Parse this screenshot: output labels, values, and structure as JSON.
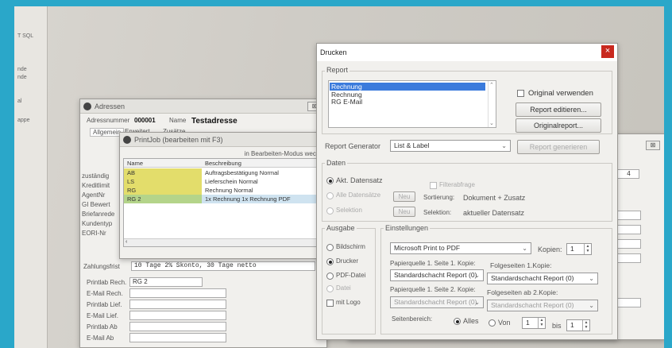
{
  "desktop": {
    "left_items": [
      "T SQL",
      "nde",
      "nde",
      "al",
      "appe"
    ]
  },
  "address_window": {
    "title": "Adressen",
    "number_label": "Adressnummer",
    "number_value": "000001",
    "name_label": "Name",
    "name_value": "Testadresse",
    "tabs": [
      "Allgemein",
      "Erweitert",
      "Zusätze"
    ],
    "side_labels": [
      "zuständig",
      "Kreditlimit",
      "AgentNr",
      "GI Bewert",
      "Briefanrede",
      "Kundentyp",
      "EORI-Nr"
    ],
    "payment_label": "Zahlungsfrist",
    "payment_text": "10 Tage 2% Skonto, 30 Tage netto",
    "bottom_fields": [
      {
        "label": "Printlab Rech.",
        "value": "RG 2"
      },
      {
        "label": "E-Mail Rech.",
        "value": ""
      },
      {
        "label": "Printlab Lief.",
        "value": ""
      },
      {
        "label": "E-Mail Lief.",
        "value": ""
      },
      {
        "label": "Printlab Ab",
        "value": ""
      },
      {
        "label": "E-Mail Ab",
        "value": ""
      }
    ]
  },
  "printlab_window": {
    "title": "PrintJob (bearbeiten mit F3)",
    "mode_hint": "in Bearbeiten-Modus wechseln",
    "columns": [
      "Name",
      "Beschreibung"
    ],
    "rows": [
      {
        "name": "AB",
        "desc": "Auftragsbestätigung Normal",
        "color": "#e3dd6b"
      },
      {
        "name": "LS",
        "desc": "Lieferschein Normal",
        "color": "#e3dd6b"
      },
      {
        "name": "RG",
        "desc": "Rechnung Normal",
        "color": "#e3dd6b"
      },
      {
        "name": "RG 2",
        "desc": "1x Rechnung 1x Rechnung PDF",
        "color": "#b4d48a"
      }
    ]
  },
  "print_dialog": {
    "title": "Drucken",
    "report_group": "Report",
    "report_list": [
      "Rechnung",
      "Rechnung",
      "RG E-Mail"
    ],
    "original_checkbox": "Original verwenden",
    "edit_button": "Report editieren...",
    "original_button": "Originalreport...",
    "generator_label": "Report Generator",
    "generator_value": "List & Label",
    "generate_button": "Report generieren",
    "data_group": "Daten",
    "radio_current": "Akt. Datensatz",
    "radio_all": "Alle Datensätze",
    "radio_selection": "Selektion",
    "filter_label": "Filterabfrage",
    "new_button": "Neu",
    "sort_label": "Sortierung:",
    "sort_value": "Dokument + Zusatz",
    "sel_label": "Selektion:",
    "sel_value": "aktueller Datensatz",
    "output_group": "Ausgabe",
    "out_screen": "Bildschirm",
    "out_printer": "Drucker",
    "out_pdf": "PDF-Datei",
    "out_file": "Datei",
    "with_logo": "mit Logo",
    "settings_group": "Einstellungen",
    "printer_value": "Microsoft Print to PDF",
    "copies_label": "Kopien:",
    "copies_value": "1",
    "paper1_label": "Papierquelle 1. Seite 1. Kopie:",
    "paper1_value": "Standardschacht Report (0)",
    "follow1_label": "Folgeseiten 1.Kopie:",
    "follow1_value": "Standardschacht Report (0)",
    "paper2_label": "Papierquelle 1. Seite 2. Kopie:",
    "paper2_value": "Standardschacht Report (0)",
    "follow2_label": "Folgeseiten ab 2.Kopie:",
    "follow2_value": "Standardschacht Report (0)",
    "range_label": "Seitenbereich:",
    "range_all": "Alles",
    "range_from": "Von",
    "range_from_value": "1",
    "range_to": "bis",
    "range_to_value": "1",
    "close_glyph": "×"
  },
  "back_window": {
    "number": "4",
    "close_glyph": "⊠"
  },
  "colors": {
    "selection": "#3b7bdc",
    "close_red": "#c8281e",
    "yellow_row": "#e3dd6b",
    "green_row": "#b4d48a"
  }
}
